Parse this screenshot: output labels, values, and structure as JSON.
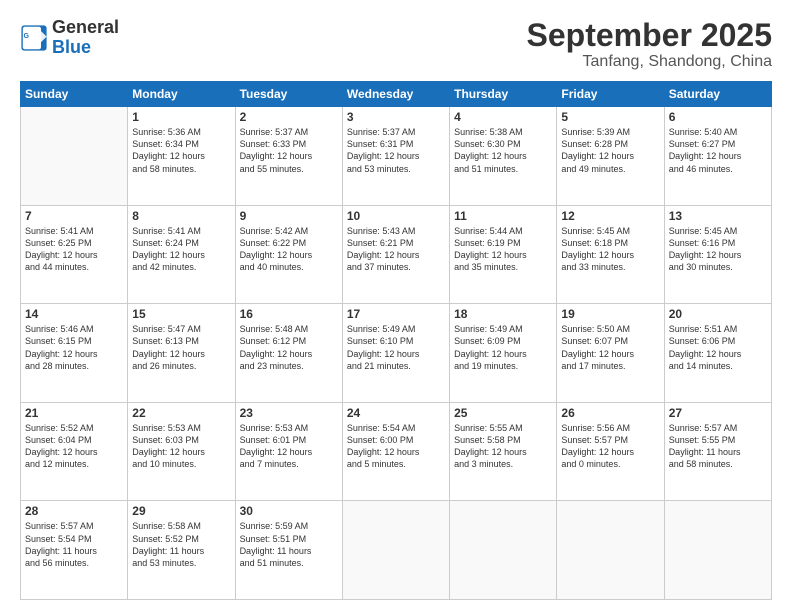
{
  "logo": {
    "line1": "General",
    "line2": "Blue"
  },
  "header": {
    "month": "September 2025",
    "location": "Tanfang, Shandong, China"
  },
  "days_of_week": [
    "Sunday",
    "Monday",
    "Tuesday",
    "Wednesday",
    "Thursday",
    "Friday",
    "Saturday"
  ],
  "weeks": [
    [
      {
        "day": "",
        "info": ""
      },
      {
        "day": "1",
        "info": "Sunrise: 5:36 AM\nSunset: 6:34 PM\nDaylight: 12 hours\nand 58 minutes."
      },
      {
        "day": "2",
        "info": "Sunrise: 5:37 AM\nSunset: 6:33 PM\nDaylight: 12 hours\nand 55 minutes."
      },
      {
        "day": "3",
        "info": "Sunrise: 5:37 AM\nSunset: 6:31 PM\nDaylight: 12 hours\nand 53 minutes."
      },
      {
        "day": "4",
        "info": "Sunrise: 5:38 AM\nSunset: 6:30 PM\nDaylight: 12 hours\nand 51 minutes."
      },
      {
        "day": "5",
        "info": "Sunrise: 5:39 AM\nSunset: 6:28 PM\nDaylight: 12 hours\nand 49 minutes."
      },
      {
        "day": "6",
        "info": "Sunrise: 5:40 AM\nSunset: 6:27 PM\nDaylight: 12 hours\nand 46 minutes."
      }
    ],
    [
      {
        "day": "7",
        "info": "Sunrise: 5:41 AM\nSunset: 6:25 PM\nDaylight: 12 hours\nand 44 minutes."
      },
      {
        "day": "8",
        "info": "Sunrise: 5:41 AM\nSunset: 6:24 PM\nDaylight: 12 hours\nand 42 minutes."
      },
      {
        "day": "9",
        "info": "Sunrise: 5:42 AM\nSunset: 6:22 PM\nDaylight: 12 hours\nand 40 minutes."
      },
      {
        "day": "10",
        "info": "Sunrise: 5:43 AM\nSunset: 6:21 PM\nDaylight: 12 hours\nand 37 minutes."
      },
      {
        "day": "11",
        "info": "Sunrise: 5:44 AM\nSunset: 6:19 PM\nDaylight: 12 hours\nand 35 minutes."
      },
      {
        "day": "12",
        "info": "Sunrise: 5:45 AM\nSunset: 6:18 PM\nDaylight: 12 hours\nand 33 minutes."
      },
      {
        "day": "13",
        "info": "Sunrise: 5:45 AM\nSunset: 6:16 PM\nDaylight: 12 hours\nand 30 minutes."
      }
    ],
    [
      {
        "day": "14",
        "info": "Sunrise: 5:46 AM\nSunset: 6:15 PM\nDaylight: 12 hours\nand 28 minutes."
      },
      {
        "day": "15",
        "info": "Sunrise: 5:47 AM\nSunset: 6:13 PM\nDaylight: 12 hours\nand 26 minutes."
      },
      {
        "day": "16",
        "info": "Sunrise: 5:48 AM\nSunset: 6:12 PM\nDaylight: 12 hours\nand 23 minutes."
      },
      {
        "day": "17",
        "info": "Sunrise: 5:49 AM\nSunset: 6:10 PM\nDaylight: 12 hours\nand 21 minutes."
      },
      {
        "day": "18",
        "info": "Sunrise: 5:49 AM\nSunset: 6:09 PM\nDaylight: 12 hours\nand 19 minutes."
      },
      {
        "day": "19",
        "info": "Sunrise: 5:50 AM\nSunset: 6:07 PM\nDaylight: 12 hours\nand 17 minutes."
      },
      {
        "day": "20",
        "info": "Sunrise: 5:51 AM\nSunset: 6:06 PM\nDaylight: 12 hours\nand 14 minutes."
      }
    ],
    [
      {
        "day": "21",
        "info": "Sunrise: 5:52 AM\nSunset: 6:04 PM\nDaylight: 12 hours\nand 12 minutes."
      },
      {
        "day": "22",
        "info": "Sunrise: 5:53 AM\nSunset: 6:03 PM\nDaylight: 12 hours\nand 10 minutes."
      },
      {
        "day": "23",
        "info": "Sunrise: 5:53 AM\nSunset: 6:01 PM\nDaylight: 12 hours\nand 7 minutes."
      },
      {
        "day": "24",
        "info": "Sunrise: 5:54 AM\nSunset: 6:00 PM\nDaylight: 12 hours\nand 5 minutes."
      },
      {
        "day": "25",
        "info": "Sunrise: 5:55 AM\nSunset: 5:58 PM\nDaylight: 12 hours\nand 3 minutes."
      },
      {
        "day": "26",
        "info": "Sunrise: 5:56 AM\nSunset: 5:57 PM\nDaylight: 12 hours\nand 0 minutes."
      },
      {
        "day": "27",
        "info": "Sunrise: 5:57 AM\nSunset: 5:55 PM\nDaylight: 11 hours\nand 58 minutes."
      }
    ],
    [
      {
        "day": "28",
        "info": "Sunrise: 5:57 AM\nSunset: 5:54 PM\nDaylight: 11 hours\nand 56 minutes."
      },
      {
        "day": "29",
        "info": "Sunrise: 5:58 AM\nSunset: 5:52 PM\nDaylight: 11 hours\nand 53 minutes."
      },
      {
        "day": "30",
        "info": "Sunrise: 5:59 AM\nSunset: 5:51 PM\nDaylight: 11 hours\nand 51 minutes."
      },
      {
        "day": "",
        "info": ""
      },
      {
        "day": "",
        "info": ""
      },
      {
        "day": "",
        "info": ""
      },
      {
        "day": "",
        "info": ""
      }
    ]
  ]
}
